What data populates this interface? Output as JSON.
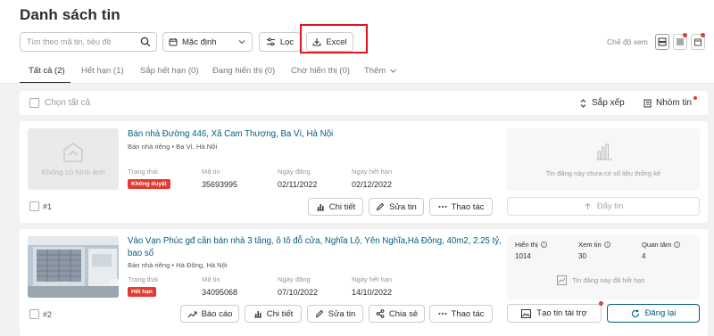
{
  "header": {
    "title": "Danh sách tin"
  },
  "toolbar": {
    "search_placeholder": "Tìm theo mã tin, tiêu đề",
    "sort_select": "Mặc định",
    "filter_label": "Lọc",
    "excel_label": "Excel",
    "view_mode_label": "Chế độ xem"
  },
  "tabs": [
    {
      "label": "Tất cả (2)",
      "active": true
    },
    {
      "label": "Hết hạn (1)"
    },
    {
      "label": "Sắp hết hạn (0)"
    },
    {
      "label": "Đang hiển thị (0)"
    },
    {
      "label": "Chờ hiển thị (0)"
    },
    {
      "label": "Thêm"
    }
  ],
  "listbar": {
    "select_all": "Chọn tất cả",
    "sort": "Sắp xếp",
    "group": "Nhóm tin"
  },
  "listings": [
    {
      "no_image": "Không có hình ảnh",
      "title": "Bán nhà Đường 446, Xã Cam Thượng, Ba Vì, Hà Nội",
      "address": "Bán nhà riêng • Ba Vì, Hà Nội",
      "status_label": "Trạng thái",
      "status": "Không duyệt",
      "id_label": "Mã tin",
      "id": "35693995",
      "posted_label": "Ngày đăng",
      "posted": "02/11/2022",
      "expiry_label": "Ngày hết hạn",
      "expiry": "02/12/2022",
      "index": "#1",
      "actions": [
        "Chi tiết",
        "Sửa tin",
        "Thao tác"
      ],
      "stats_msg": "Tin đăng này chưa có số liệu thống kê",
      "push_label": "Đẩy tin"
    },
    {
      "title": "Vào Vạn Phúc gđ cần bán nhà 3 tầng, ô tô đỗ cửa, Nghĩa Lộ, Yên Nghĩa,Hà Đông, 40m2, 2.25 tỷ, bao sổ",
      "address": "Bán nhà riêng • Hà Đông, Hà Nội",
      "status_label": "Trạng thái",
      "status": "Hết hạn",
      "id_label": "Mã tin",
      "id": "34095068",
      "posted_label": "Ngày đăng",
      "posted": "07/10/2022",
      "expiry_label": "Ngày hết hạn",
      "expiry": "14/10/2022",
      "index": "#2",
      "actions": [
        "Báo cáo",
        "Chi tiết",
        "Sửa tin",
        "Chia sẻ",
        "Thao tác"
      ],
      "stats": {
        "views_label": "Hiển thị",
        "views": "1014",
        "reads_label": "Xem tin",
        "reads": "30",
        "interest_label": "Quan tâm",
        "interest": "4"
      },
      "expired_msg": "Tin đăng này đã hết hạn",
      "sponsor_label": "Tạo tin tài trợ",
      "repost_label": "Đăng lại"
    }
  ],
  "colors": {
    "accent": "#015d7e",
    "danger": "#e03c31",
    "highlight": "#e0141e"
  }
}
